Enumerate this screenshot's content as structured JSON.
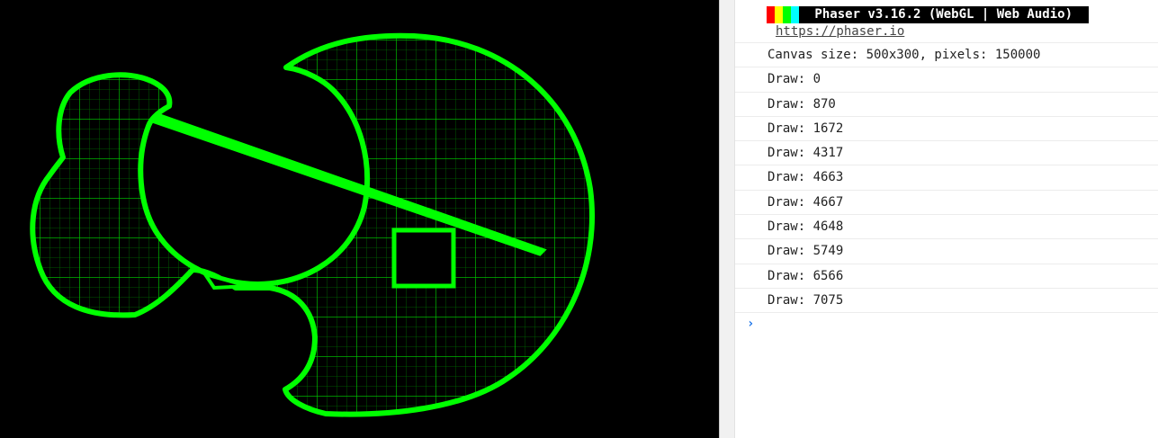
{
  "canvas": {
    "stroke_color": "#00ff00",
    "background": "#000000"
  },
  "console": {
    "banner": {
      "text": " Phaser v3.16.2 (WebGL | Web Audio) ",
      "swatch_colors": [
        "#ff0000",
        "#ffff00",
        "#00ff00",
        "#00ffff"
      ],
      "link": "https://phaser.io"
    },
    "lines": [
      "Canvas size: 500x300, pixels: 150000",
      "Draw: 0",
      "Draw: 870",
      "Draw: 1672",
      "Draw: 4317",
      "Draw: 4663",
      "Draw: 4667",
      "Draw: 4648",
      "Draw: 5749",
      "Draw: 6566",
      "Draw: 7075"
    ],
    "prompt_icon": "chevron-right-icon",
    "prompt_glyph": "›"
  }
}
